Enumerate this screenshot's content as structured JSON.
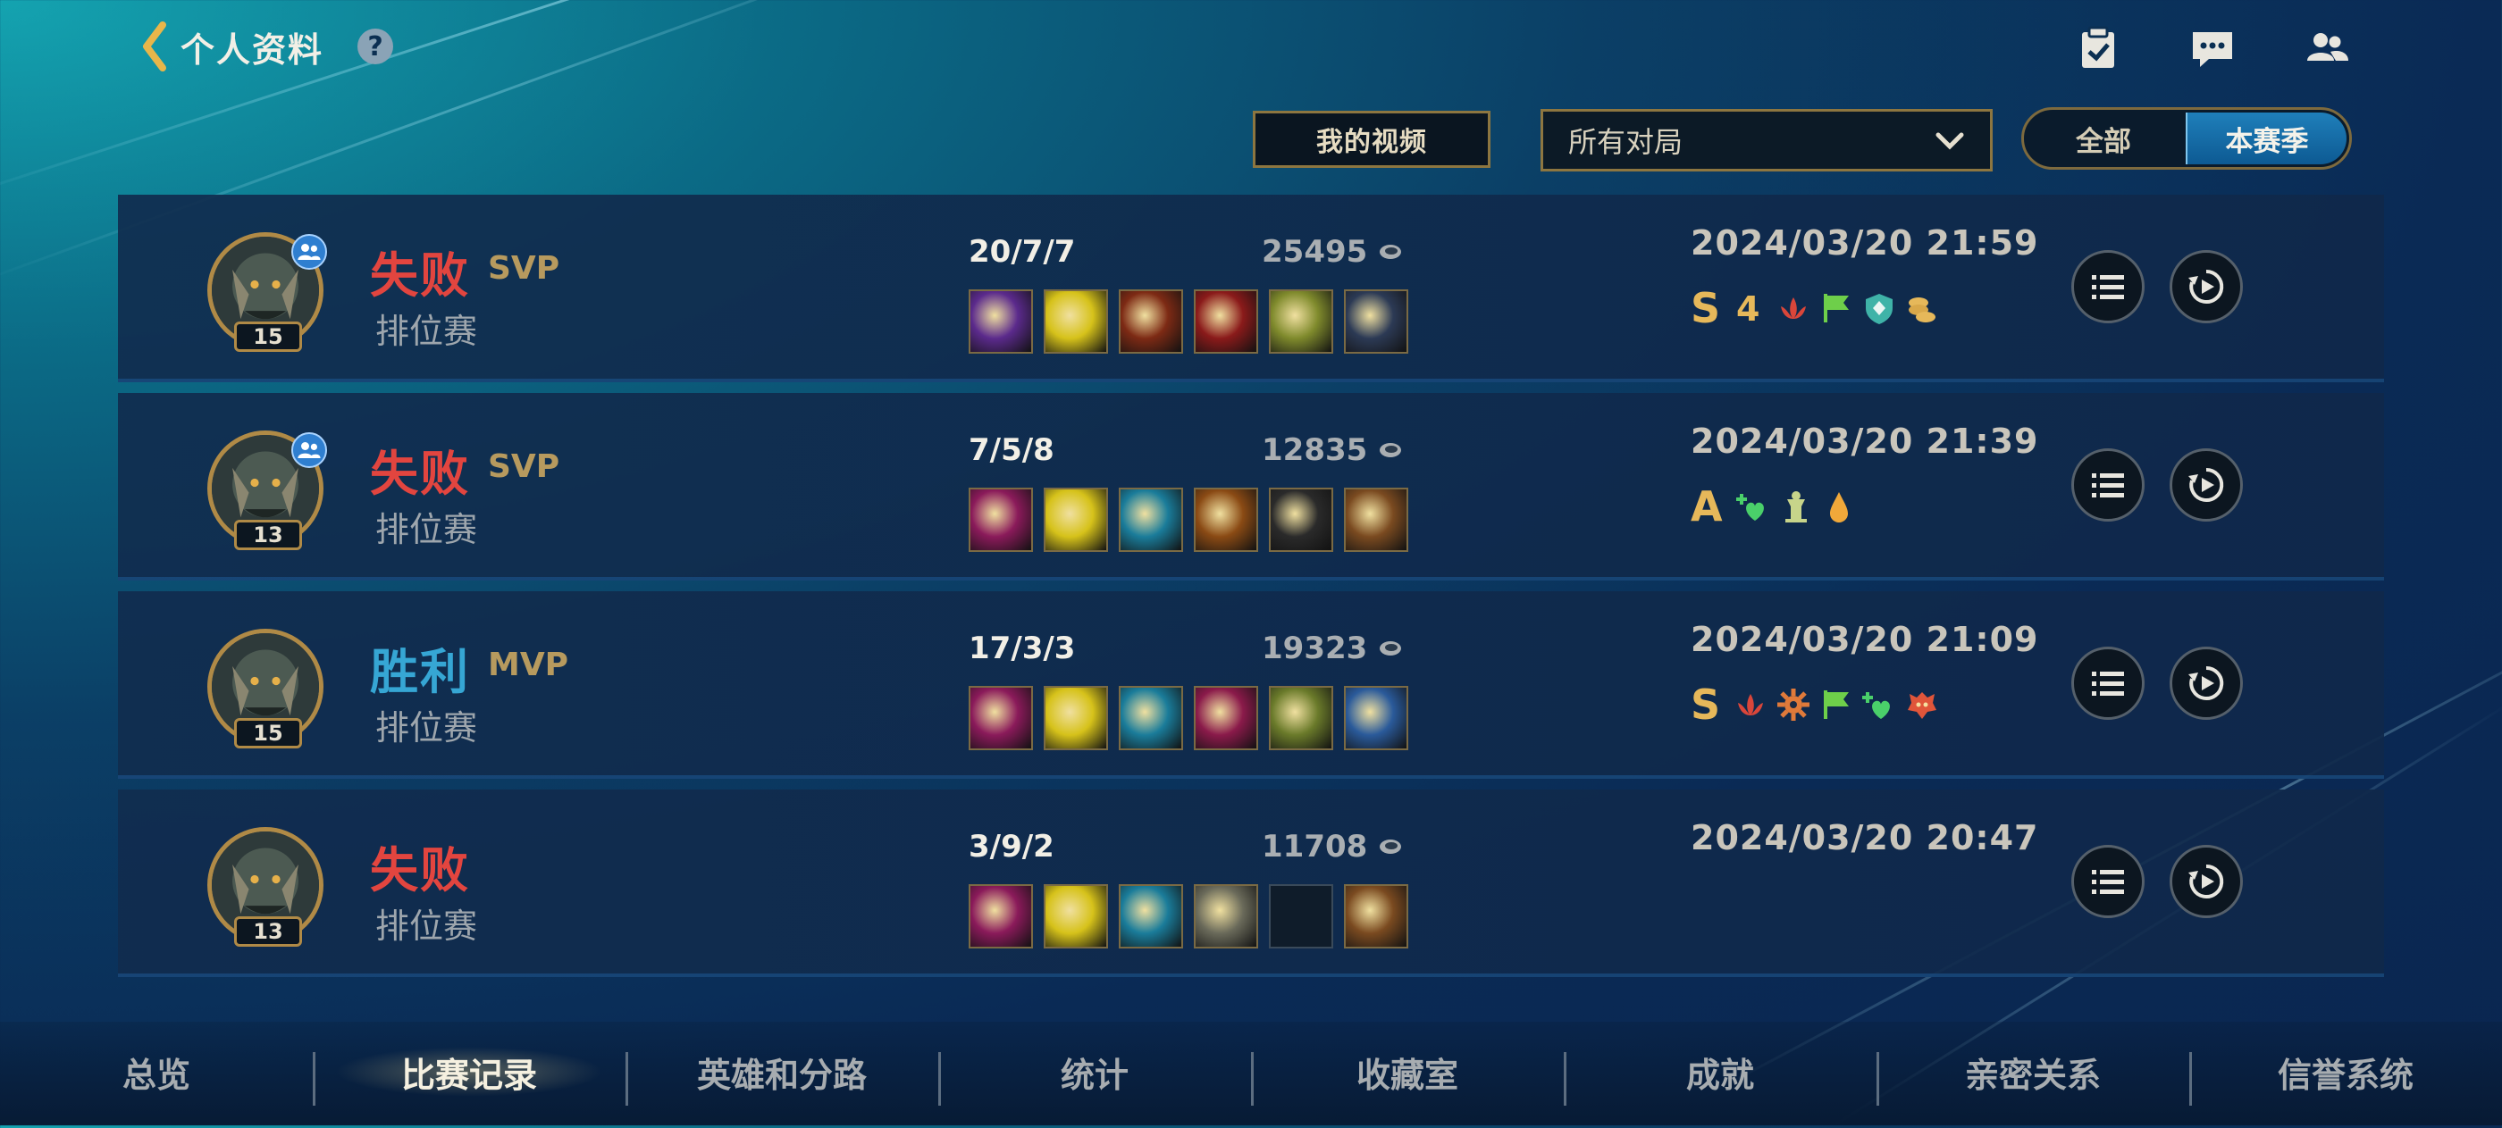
{
  "header": {
    "title": "个人资料",
    "help": "?"
  },
  "filters": {
    "video_button": "我的视频",
    "match_type": "所有对局",
    "season_toggle": {
      "all": "全部",
      "current": "本赛季",
      "selected": "本赛季"
    }
  },
  "matches": [
    {
      "result": "失败",
      "result_type": "lose",
      "rank": "SVP",
      "mode": "排位赛",
      "level": "15",
      "party": true,
      "kda": "20/7/7",
      "gold": "25495",
      "time": "2024/03/20 21:59",
      "grade": "S",
      "items": [
        "#5b2a8c",
        "#d6c21a",
        "#7d2a14",
        "#8a1a1a",
        "#7f8a2c",
        "#2c3a55"
      ],
      "badges": [
        "four-kill",
        "lotus",
        "flag",
        "shield",
        "coins"
      ]
    },
    {
      "result": "失败",
      "result_type": "lose",
      "rank": "SVP",
      "mode": "排位赛",
      "level": "13",
      "party": true,
      "kda": "7/5/8",
      "gold": "12835",
      "time": "2024/03/20 21:39",
      "grade": "A",
      "items": [
        "#8a1a5a",
        "#d6c21a",
        "#1a7c9a",
        "#8a4a14",
        "#2a2a2a",
        "#7a4a20"
      ],
      "badges": [
        "heal",
        "tower",
        "drop"
      ]
    },
    {
      "result": "胜利",
      "result_type": "win",
      "rank": "MVP",
      "mode": "排位赛",
      "level": "15",
      "party": false,
      "kda": "17/3/3",
      "gold": "19323",
      "time": "2024/03/20 21:09",
      "grade": "S",
      "items": [
        "#8a1a5a",
        "#d6c21a",
        "#1a7c9a",
        "#8a1a4a",
        "#6a7a2a",
        "#2a5a9a"
      ],
      "badges": [
        "lotus",
        "gear",
        "flag",
        "heal",
        "dragon"
      ]
    },
    {
      "result": "失败",
      "result_type": "lose",
      "rank": "",
      "mode": "排位赛",
      "level": "13",
      "party": false,
      "kda": "3/9/2",
      "gold": "11708",
      "time": "2024/03/20 20:47",
      "grade": "",
      "items": [
        "#8a1a5a",
        "#d6c21a",
        "#1a7c9a",
        "#6a6a5a",
        "",
        "#7a4a20"
      ],
      "badges": []
    }
  ],
  "tabs": [
    "总览",
    "比赛记录",
    "英雄和分路",
    "统计",
    "收藏室",
    "成就",
    "亲密关系",
    "信誉系统"
  ],
  "active_tab": "比赛记录",
  "colors": {
    "lose": "#e2453f",
    "win": "#36a6d4",
    "gold_accent": "#b79a5e"
  }
}
